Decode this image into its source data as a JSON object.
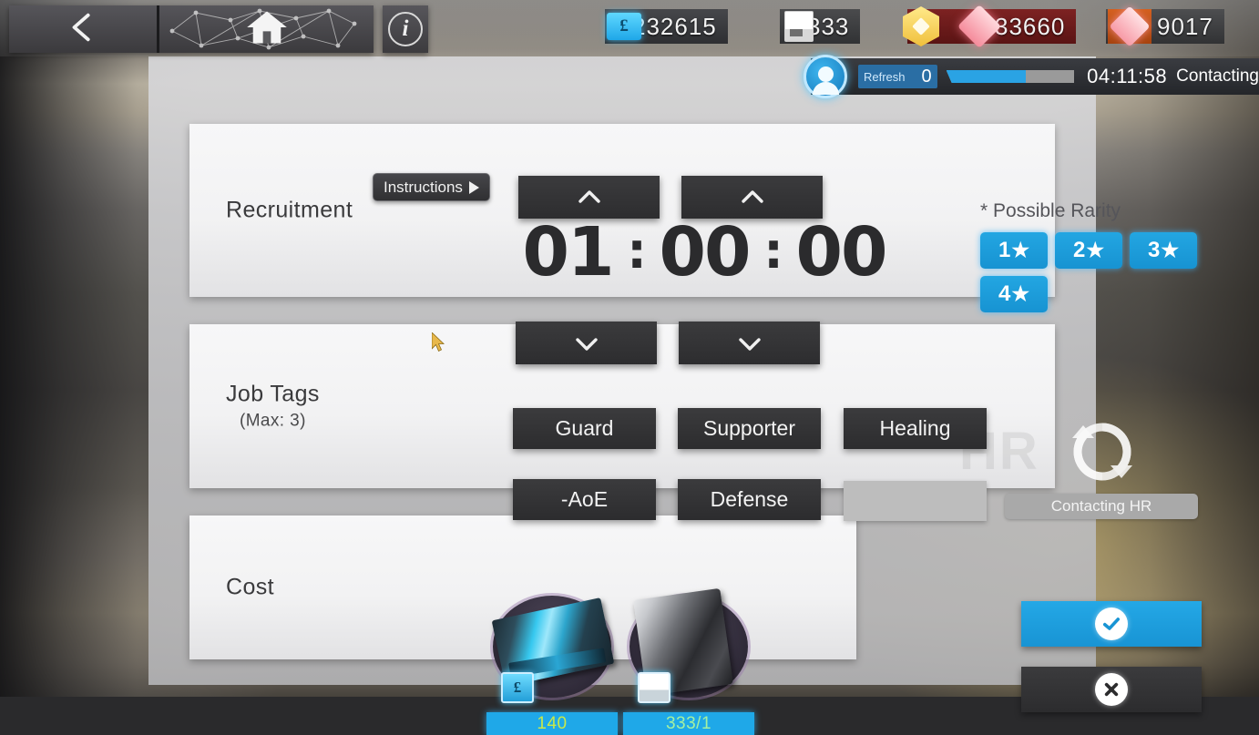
{
  "topbar": {
    "back_icon": "chevron-left-icon",
    "home_icon": "home-icon",
    "info_label": "i",
    "currencies": [
      {
        "name": "lmd",
        "icon": "lmd-icon",
        "value": "232615"
      },
      {
        "name": "recruit-permit",
        "icon": "recruitment-permit-icon",
        "value": "333"
      },
      {
        "name": "originite-prime",
        "icon": "originite-prime-icon",
        "value": "33660"
      },
      {
        "name": "orundum",
        "icon": "orundum-icon",
        "value": "9017"
      }
    ]
  },
  "refresh_row": {
    "avatar_icon": "operator-avatar-icon",
    "label": "Refresh",
    "count": "0",
    "progress_percent": 62,
    "timer": "04:11:58",
    "status": "Contacting"
  },
  "instructions": {
    "label": "Instructions",
    "arrow_icon": "play-triangle-icon"
  },
  "recruitment": {
    "label": "Recruitment",
    "hours": "01",
    "minutes": "00",
    "seconds": "00",
    "separator": ":",
    "up_icon": "chevron-up-icon",
    "down_icon": "chevron-down-icon"
  },
  "rarity": {
    "title": "* Possible Rarity",
    "options": [
      {
        "label": "1",
        "star": "★"
      },
      {
        "label": "2",
        "star": "★"
      },
      {
        "label": "3",
        "star": "★"
      },
      {
        "label": "4",
        "star": "★"
      }
    ],
    "accent_color": "#1fa3e0"
  },
  "job_tags": {
    "label": "Job Tags",
    "sub_label": "(Max: 3)",
    "tags": [
      {
        "name": "guard",
        "label": "Guard"
      },
      {
        "name": "supporter",
        "label": "Supporter"
      },
      {
        "name": "healing",
        "label": "Healing"
      },
      {
        "name": "aoe",
        "label": "-AoE"
      },
      {
        "name": "defense",
        "label": "Defense"
      },
      {
        "name": "empty",
        "label": ""
      }
    ],
    "refresh_icon": "sync-refresh-icon",
    "contact_hr_label": "Contacting HR"
  },
  "cost": {
    "label": "Cost",
    "items": [
      {
        "name": "lmd",
        "icon": "lmd-item-icon",
        "quantity": "140",
        "badge_glyph": "£"
      },
      {
        "name": "recruitment-permit",
        "icon": "recruitment-permit-item-icon",
        "quantity": "333/1",
        "badge_glyph": ""
      }
    ]
  },
  "actions": {
    "confirm_icon": "check-circle-icon",
    "cancel_icon": "close-circle-icon"
  },
  "cursor": {
    "icon": "mouse-cursor-icon"
  }
}
